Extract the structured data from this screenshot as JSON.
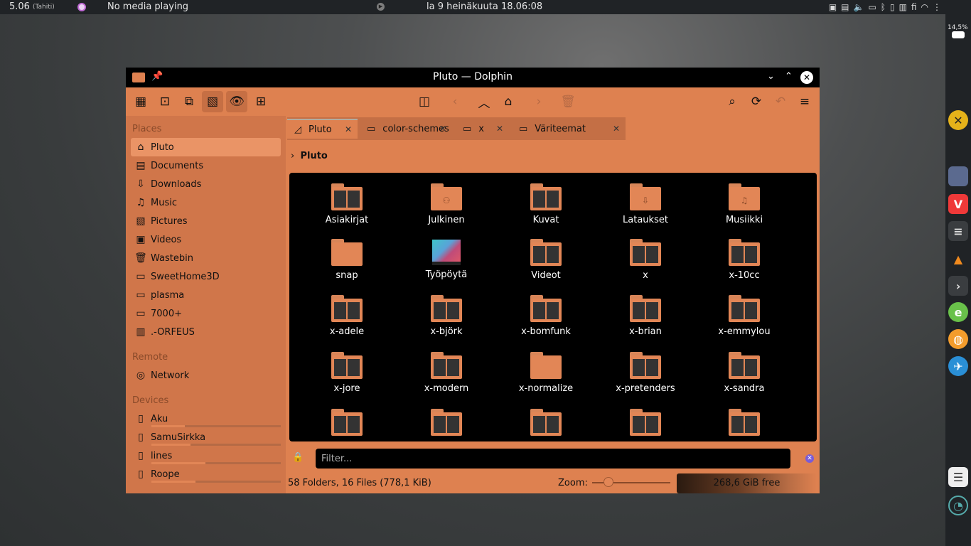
{
  "topbar": {
    "time": "5.06",
    "timezone": "(Tahiti)",
    "media": "No media playing",
    "datetime": "la 9 heinäkuuta 18.06:08",
    "lang": "fi"
  },
  "dock": {
    "battery": "14,5%"
  },
  "window": {
    "title": "Pluto — Dolphin"
  },
  "places": {
    "heading": "Places",
    "items": [
      {
        "label": "Pluto",
        "icon": "home-icon"
      },
      {
        "label": "Documents",
        "icon": "documents-icon"
      },
      {
        "label": "Downloads",
        "icon": "download-icon"
      },
      {
        "label": "Music",
        "icon": "music-icon"
      },
      {
        "label": "Pictures",
        "icon": "pictures-icon"
      },
      {
        "label": "Videos",
        "icon": "videos-icon"
      },
      {
        "label": "Wastebin",
        "icon": "trash-icon"
      },
      {
        "label": "SweetHome3D",
        "icon": "folder-icon"
      },
      {
        "label": "plasma",
        "icon": "folder-icon"
      },
      {
        "label": "7000+",
        "icon": "folder-icon"
      },
      {
        "label": ".-ORFEUS",
        "icon": "colorful-folder-icon"
      }
    ],
    "remote_heading": "Remote",
    "remote_items": [
      {
        "label": "Network",
        "icon": "network-icon"
      }
    ],
    "devices_heading": "Devices",
    "devices": [
      {
        "label": "Aku",
        "usage": 0.26
      },
      {
        "label": "SamuSirkka",
        "usage": 0.3
      },
      {
        "label": "lines",
        "usage": 0.42
      },
      {
        "label": "Roope",
        "usage": 0.34
      }
    ]
  },
  "tabs": [
    {
      "label": "Pluto",
      "active": true
    },
    {
      "label": "color-schemes",
      "active": false
    },
    {
      "label": "x",
      "active": false
    },
    {
      "label": "Väriteemat",
      "active": false
    }
  ],
  "breadcrumb": "Pluto",
  "files": [
    {
      "name": "Asiakirjat",
      "kind": "thumbs"
    },
    {
      "name": "Julkinen",
      "kind": "badge",
      "badge": "⚇"
    },
    {
      "name": "Kuvat",
      "kind": "thumbs"
    },
    {
      "name": "Lataukset",
      "kind": "badge",
      "badge": "⇩"
    },
    {
      "name": "Musiikki",
      "kind": "badge",
      "badge": "♫"
    },
    {
      "name": "snap",
      "kind": "plain"
    },
    {
      "name": "Työpöytä",
      "kind": "tile"
    },
    {
      "name": "Videot",
      "kind": "thumbs"
    },
    {
      "name": "x",
      "kind": "thumbs"
    },
    {
      "name": "x-10cc",
      "kind": "thumbs"
    },
    {
      "name": "x-adele",
      "kind": "thumbs"
    },
    {
      "name": "x-björk",
      "kind": "thumbs"
    },
    {
      "name": "x-bomfunk",
      "kind": "thumbs"
    },
    {
      "name": "x-brian",
      "kind": "thumbs"
    },
    {
      "name": "x-emmylou",
      "kind": "thumbs"
    },
    {
      "name": "x-jore",
      "kind": "thumbs"
    },
    {
      "name": "x-modern",
      "kind": "thumbs"
    },
    {
      "name": "x-normalize",
      "kind": "plain"
    },
    {
      "name": "x-pretenders",
      "kind": "thumbs"
    },
    {
      "name": "x-sandra",
      "kind": "thumbs"
    },
    {
      "name": "",
      "kind": "thumbs"
    },
    {
      "name": "",
      "kind": "thumbs"
    },
    {
      "name": "",
      "kind": "thumbs"
    },
    {
      "name": "",
      "kind": "thumbs"
    },
    {
      "name": "",
      "kind": "thumbs"
    }
  ],
  "filter": {
    "placeholder": "Filter..."
  },
  "status": {
    "summary": "58 Folders, 16 Files (778,1 KiB)",
    "zoom_label": "Zoom:",
    "free": "268,6 GiB free"
  },
  "colors": {
    "accent": "#de8150",
    "sidebar": "#d0764a",
    "view_bg": "#000000"
  }
}
